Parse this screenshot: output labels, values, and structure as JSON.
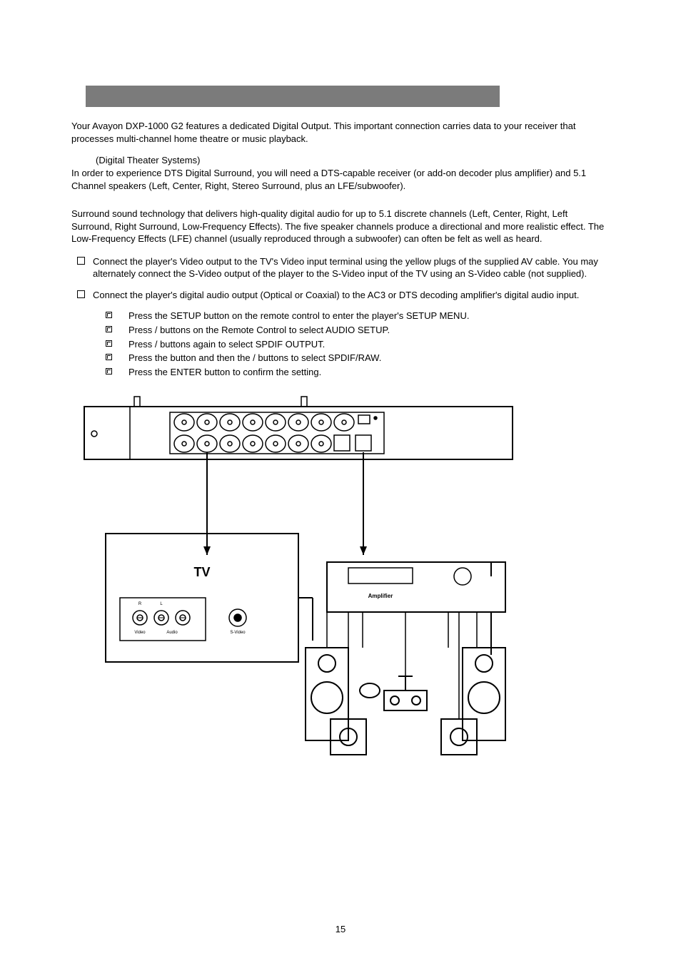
{
  "intro": "Your Avayon DXP-1000 G2 features a dedicated Digital Output. This important connection carries data to your receiver that processes multi-channel home theatre or music playback.",
  "dts_label": "(Digital Theater Systems)",
  "dts_body": "In order to experience DTS Digital Surround, you will need a DTS-capable receiver (or add-on decoder plus amplifier) and 5.1 Channel speakers (Left, Center, Right, Stereo Surround, plus an LFE/subwoofer).",
  "surround_body": "Surround sound technology that delivers high-quality digital audio for up to 5.1 discrete channels (Left, Center, Right, Left Surround, Right Surround, Low-Frequency Effects). The five speaker channels produce a directional and more realistic effect. The Low-Frequency Effects (LFE) channel (usually reproduced through a subwoofer) can often be felt as well as heard.",
  "steps": {
    "s1": "Connect the player's Video output to the TV's Video input terminal using the yellow plugs of the supplied AV cable. You may alternately connect the S-Video output of the player to the S-Video input of the TV using an S-Video cable (not supplied).",
    "s2": "Connect the player's digital audio output (Optical or Coaxial) to the AC3 or DTS decoding amplifier's digital audio input."
  },
  "setup": {
    "i1": "Press the SETUP button on the remote control to enter the player's SETUP MENU.",
    "i2": "Press    /    buttons on the Remote Control to select AUDIO SETUP.",
    "i3": "Press    /    buttons again to select SPDIF OUTPUT.",
    "i4": "Press the    button and then the    /    buttons to select SPDIF/RAW.",
    "i5": "Press the ENTER button to confirm the setting."
  },
  "diagram": {
    "tv": "TV",
    "amplifier": "Amplifier",
    "video": "Video",
    "audio": "Audio",
    "svideo": "S-Video",
    "r": "R",
    "l": "L"
  },
  "page_number": "15"
}
